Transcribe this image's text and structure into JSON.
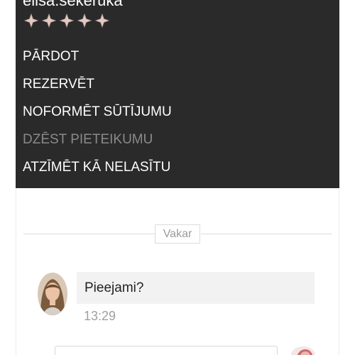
{
  "profile": {
    "username": "elisa.sekeruka",
    "rating_max": 5,
    "rating_value": 5,
    "rating_icon": "four-point-star-icon",
    "star_color": "#e4c9c3"
  },
  "menu": {
    "background": "#2a2a2a",
    "items": [
      {
        "label": "PĀRDOT",
        "enabled": true
      },
      {
        "label": "REZERVĒT",
        "enabled": true
      },
      {
        "label": "NOFORMĒT SŪTĪJUMU",
        "enabled": true
      },
      {
        "label": "DZĒST PIETEIKUMU",
        "enabled": false
      },
      {
        "label": "ATZĪMĒT KĀ NELASĪTU",
        "enabled": true
      }
    ]
  },
  "chat": {
    "date_separator": "Vakar",
    "messages": [
      {
        "text": "Pieejami?",
        "time": "13:29",
        "sender_avatar": "user-avatar"
      }
    ]
  }
}
